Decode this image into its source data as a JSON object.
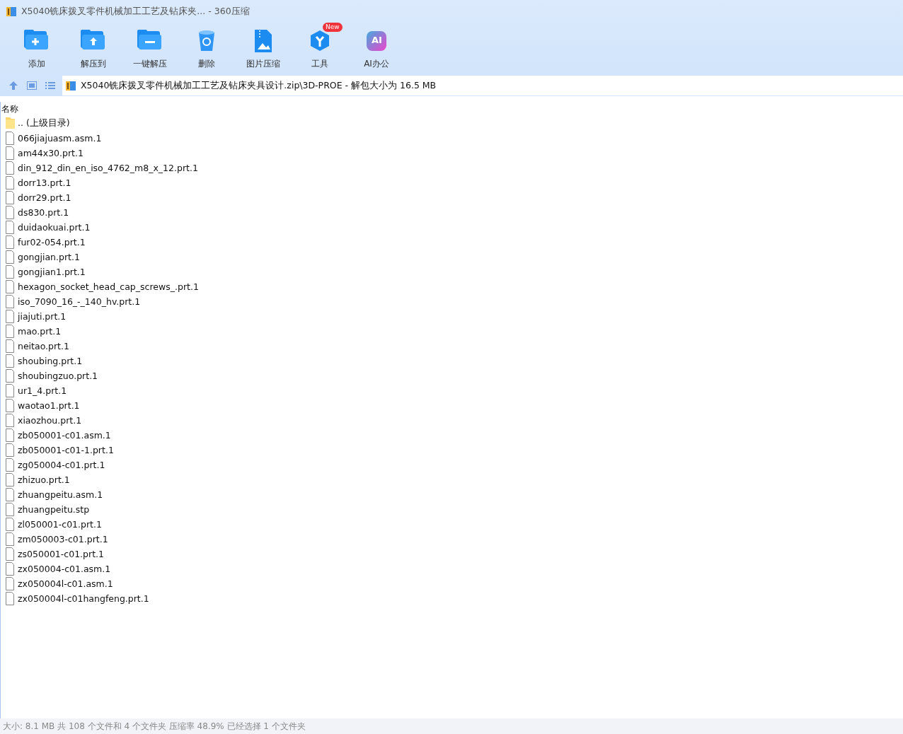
{
  "window": {
    "title": "X5040铣床拨叉零件机械加工工艺及钻床夹... - 360压缩"
  },
  "toolbar": [
    {
      "kind": "add",
      "label": "添加"
    },
    {
      "kind": "extract",
      "label": "解压到"
    },
    {
      "kind": "oneclick",
      "label": "一键解压"
    },
    {
      "kind": "delete",
      "label": "删除"
    },
    {
      "kind": "image",
      "label": "图片压缩"
    },
    {
      "kind": "tools",
      "label": "工具",
      "badge": "New"
    },
    {
      "kind": "ai",
      "label": "AI办公",
      "logo": "AI"
    }
  ],
  "address": {
    "path": "X5040铣床拨叉零件机械加工工艺及钻床夹具设计.zip\\3D-PROE - 解包大小为 16.5 MB"
  },
  "table": {
    "columns": [
      "名称"
    ],
    "rows": [
      {
        "kind": "folder",
        "name": ".. (上级目录)"
      },
      {
        "kind": "file",
        "name": "066jiajuasm.asm.1"
      },
      {
        "kind": "file",
        "name": "am44x30.prt.1"
      },
      {
        "kind": "file",
        "name": "din_912_din_en_iso_4762_m8_x_12.prt.1"
      },
      {
        "kind": "file",
        "name": "dorr13.prt.1"
      },
      {
        "kind": "file",
        "name": "dorr29.prt.1"
      },
      {
        "kind": "file",
        "name": "ds830.prt.1"
      },
      {
        "kind": "file",
        "name": "duidaokuai.prt.1"
      },
      {
        "kind": "file",
        "name": "fur02-054.prt.1"
      },
      {
        "kind": "file",
        "name": "gongjian.prt.1"
      },
      {
        "kind": "file",
        "name": "gongjian1.prt.1"
      },
      {
        "kind": "file",
        "name": "hexagon_socket_head_cap_screws_.prt.1"
      },
      {
        "kind": "file",
        "name": "iso_7090_16_-_140_hv.prt.1"
      },
      {
        "kind": "file",
        "name": "jiajuti.prt.1"
      },
      {
        "kind": "file",
        "name": "mao.prt.1"
      },
      {
        "kind": "file",
        "name": "neitao.prt.1"
      },
      {
        "kind": "file",
        "name": "shoubing.prt.1"
      },
      {
        "kind": "file",
        "name": "shoubingzuo.prt.1"
      },
      {
        "kind": "file",
        "name": "ur1_4.prt.1"
      },
      {
        "kind": "file",
        "name": "waotao1.prt.1"
      },
      {
        "kind": "file",
        "name": "xiaozhou.prt.1"
      },
      {
        "kind": "file",
        "name": "zb050001-c01.asm.1"
      },
      {
        "kind": "file",
        "name": "zb050001-c01-1.prt.1"
      },
      {
        "kind": "file",
        "name": "zg050004-c01.prt.1"
      },
      {
        "kind": "file",
        "name": "zhizuo.prt.1"
      },
      {
        "kind": "file",
        "name": "zhuangpeitu.asm.1"
      },
      {
        "kind": "file",
        "name": "zhuangpeitu.stp"
      },
      {
        "kind": "file",
        "name": "zl050001-c01.prt.1"
      },
      {
        "kind": "file",
        "name": "zm050003-c01.prt.1"
      },
      {
        "kind": "file",
        "name": "zs050001-c01.prt.1"
      },
      {
        "kind": "file",
        "name": "zx050004-c01.asm.1"
      },
      {
        "kind": "file",
        "name": "zx050004l-c01.asm.1"
      },
      {
        "kind": "file",
        "name": "zx050004l-c01hangfeng.prt.1"
      }
    ]
  },
  "status_bar": "大小: 8.1 MB 共 108 个文件和 4 个文件夹 压缩率 48.9% 已经选择 1 个文件夹"
}
